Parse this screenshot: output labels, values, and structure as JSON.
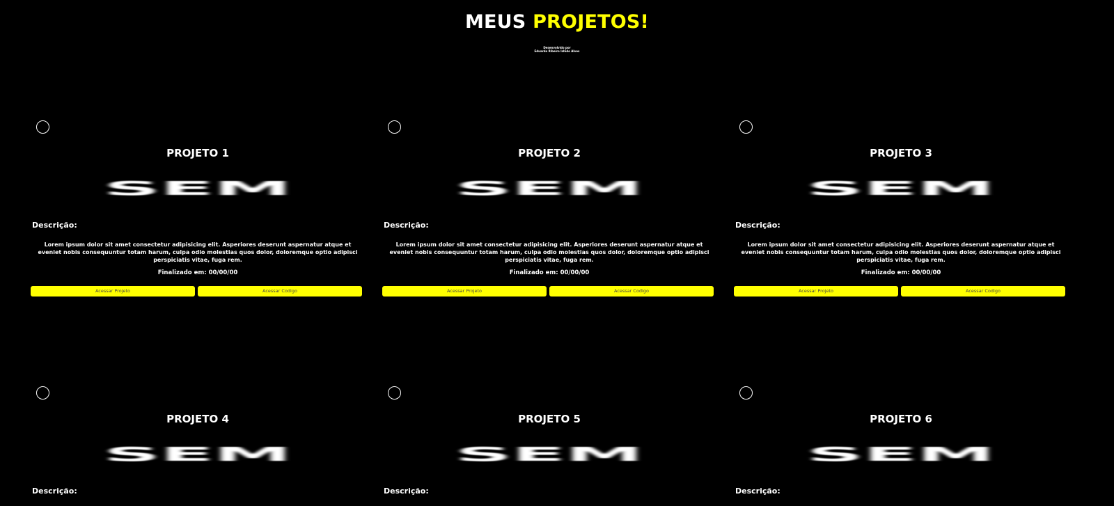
{
  "header": {
    "title_part1": "MEUS ",
    "title_part2": "PROJETOS!",
    "subtitle_line1": "Desenvolvido por",
    "subtitle_line2": "Eduardo Ribeiro Ishido Alves"
  },
  "colors": {
    "background": "#000000",
    "accent": "#ffff00",
    "text": "#ffffff"
  },
  "placeholder_image_text": "SEM",
  "cards": [
    {
      "title": "PROJETO 1",
      "description_label": "Descrição:",
      "description": "Lorem ipsum dolor sit amet consectetur adipisicing elit. Asperiores deserunt aspernatur atque et eveniet nobis consequuntur totam harum, culpa odio molestias quos dolor, doloremque optio adipisci perspiciatis vitae, fuga rem.",
      "finished": "Finalizado em: 00/00/00",
      "btn_project": "Acessar Projeto",
      "btn_code": "Acessar Codigo"
    },
    {
      "title": "PROJETO 2",
      "description_label": "Descrição:",
      "description": "Lorem ipsum dolor sit amet consectetur adipisicing elit. Asperiores deserunt aspernatur atque et eveniet nobis consequuntur totam harum, culpa odio molestias quos dolor, doloremque optio adipisci perspiciatis vitae, fuga rem.",
      "finished": "Finalizado em: 00/00/00",
      "btn_project": "Acessar Projeto",
      "btn_code": "Acessar Codigo"
    },
    {
      "title": "PROJETO 3",
      "description_label": "Descrição:",
      "description": "Lorem ipsum dolor sit amet consectetur adipisicing elit. Asperiores deserunt aspernatur atque et eveniet nobis consequuntur totam harum, culpa odio molestias quos dolor, doloremque optio adipisci perspiciatis vitae, fuga rem.",
      "finished": "Finalizado em: 00/00/00",
      "btn_project": "Acessar Projeto",
      "btn_code": "Acessar Codigo"
    },
    {
      "title": "PROJETO 4",
      "description_label": "Descrição:"
    },
    {
      "title": "PROJETO 5",
      "description_label": "Descrição:"
    },
    {
      "title": "PROJETO 6",
      "description_label": "Descrição:"
    }
  ]
}
